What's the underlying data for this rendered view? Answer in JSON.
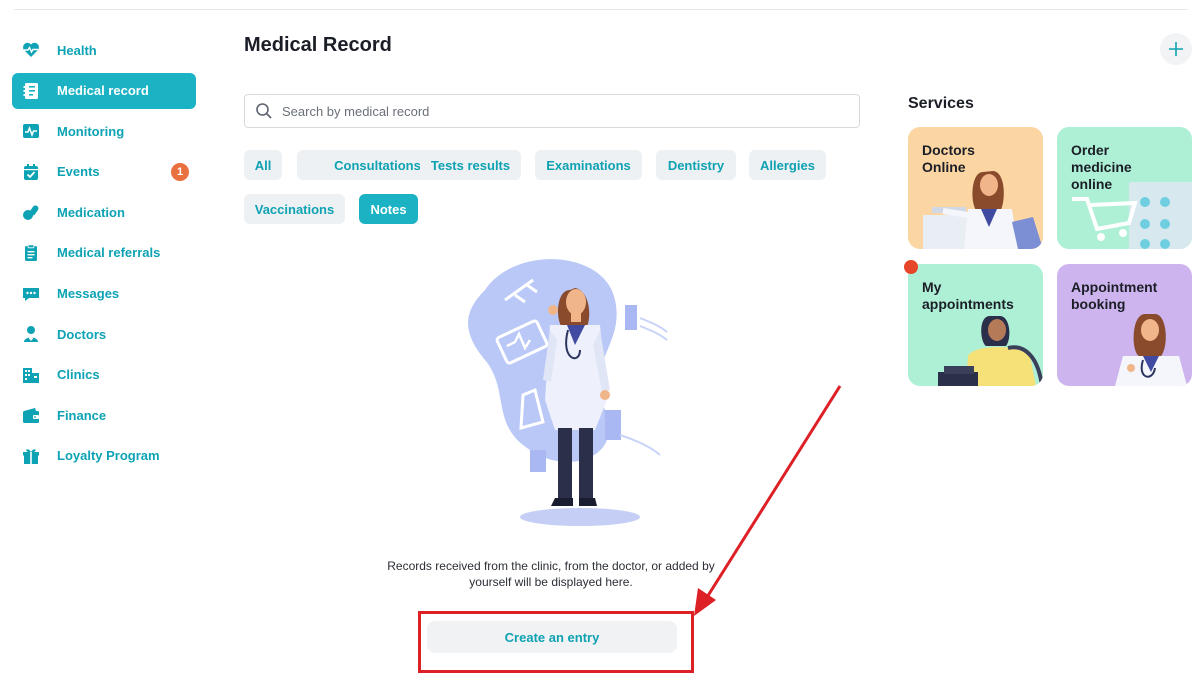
{
  "sidebar": {
    "items": [
      {
        "label": "Health",
        "icon": "heart-pulse-icon"
      },
      {
        "label": "Medical record",
        "icon": "notebook-icon",
        "active": true
      },
      {
        "label": "Monitoring",
        "icon": "chart-monitor-icon"
      },
      {
        "label": "Events",
        "icon": "calendar-check-icon",
        "badge": "1"
      },
      {
        "label": "Medication",
        "icon": "pills-icon"
      },
      {
        "label": "Medical referrals",
        "icon": "clipboard-icon"
      },
      {
        "label": "Messages",
        "icon": "chat-icon"
      },
      {
        "label": "Doctors",
        "icon": "doctor-icon"
      },
      {
        "label": "Clinics",
        "icon": "building-icon"
      },
      {
        "label": "Finance",
        "icon": "wallet-icon"
      },
      {
        "label": "Loyalty Program",
        "icon": "gift-icon"
      }
    ]
  },
  "main": {
    "title": "Medical Record",
    "search_placeholder": "Search by medical record",
    "filters": [
      {
        "label": "All"
      },
      {
        "label": "Consultations"
      },
      {
        "label": "Tests results"
      },
      {
        "label": "Examinations"
      },
      {
        "label": "Dentistry"
      },
      {
        "label": "Allergies"
      },
      {
        "label": "Vaccinations"
      },
      {
        "label": "Notes",
        "active": true
      }
    ],
    "empty_text": "Records received from the clinic, from the doctor, or added by yourself will be displayed here.",
    "create_label": "Create an entry"
  },
  "services": {
    "title": "Services",
    "cards": [
      {
        "title": "Doctors\nOnline",
        "color": "#fbd5a2"
      },
      {
        "title": "Order\nmedicine\nonline",
        "color": "#aef0d6"
      },
      {
        "title": "My\nappointments",
        "color": "#aef0d6",
        "notification": true
      },
      {
        "title": "Appointment\nbooking",
        "color": "#cdb4ee"
      }
    ]
  },
  "colors": {
    "accent": "#1bb3c3",
    "accent_text": "#0ea2b2",
    "badge": "#e9703f",
    "annotation_red": "#dd1f26"
  }
}
